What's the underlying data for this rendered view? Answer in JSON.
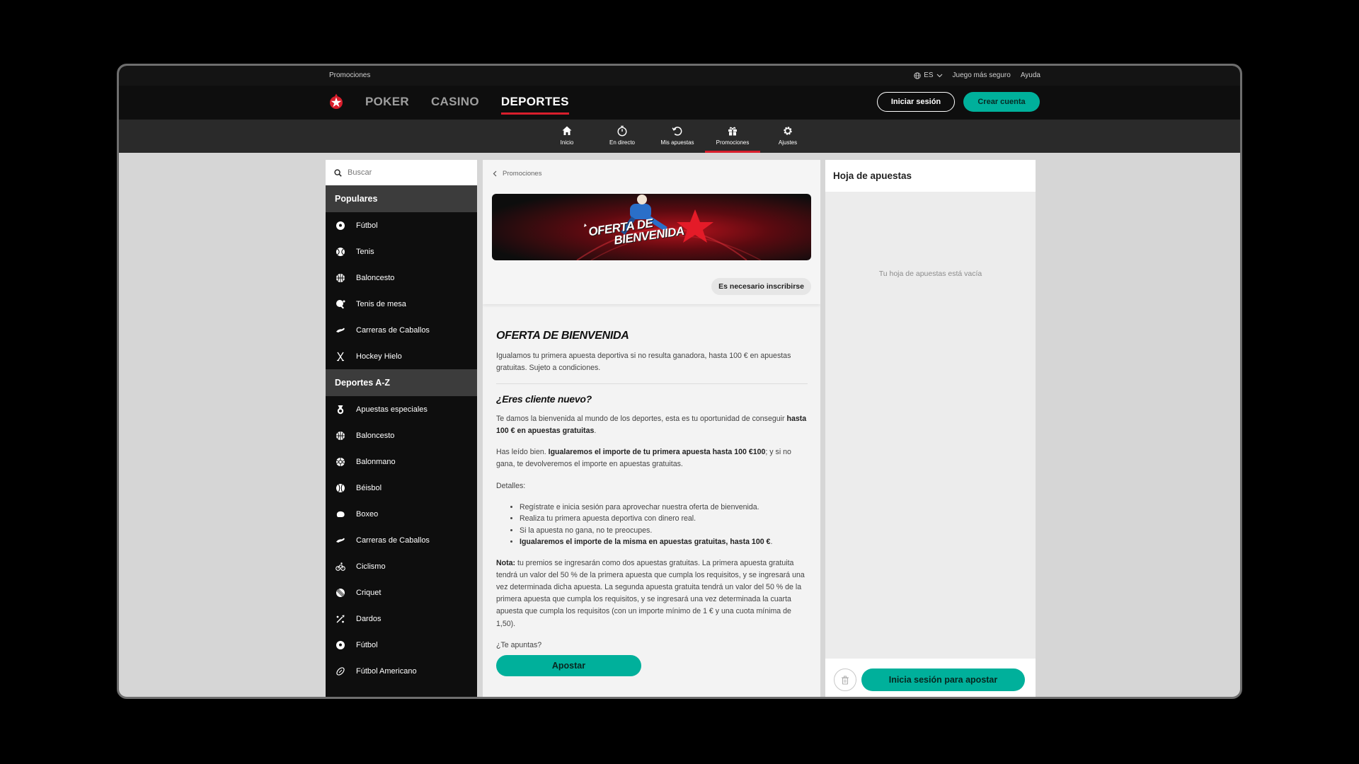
{
  "utility_bar": {
    "breadcrumb": "Promociones",
    "language": "ES",
    "safe_gaming": "Juego más seguro",
    "help": "Ayuda"
  },
  "header": {
    "nav": [
      "POKER",
      "CASINO",
      "DEPORTES"
    ],
    "active_nav": "DEPORTES",
    "login_label": "Iniciar sesión",
    "create_account_label": "Crear cuenta"
  },
  "subnav": {
    "items": [
      {
        "label": "Inicio",
        "icon": "home-icon"
      },
      {
        "label": "En directo",
        "icon": "stopwatch-icon"
      },
      {
        "label": "Mis apuestas",
        "icon": "history-icon"
      },
      {
        "label": "Promociones",
        "icon": "gift-icon"
      },
      {
        "label": "Ajustes",
        "icon": "gear-icon"
      }
    ],
    "active": "Promociones"
  },
  "sidebar": {
    "search_placeholder": "Buscar",
    "popular_title": "Populares",
    "popular": [
      "Fútbol",
      "Tenis",
      "Baloncesto",
      "Tenis de mesa",
      "Carreras de Caballos",
      "Hockey Hielo"
    ],
    "az_title": "Deportes A-Z",
    "az": [
      "Apuestas especiales",
      "Baloncesto",
      "Balonmano",
      "Béisbol",
      "Boxeo",
      "Carreras de Caballos",
      "Ciclismo",
      "Criquet",
      "Dardos",
      "Fútbol",
      "Fútbol Americano"
    ]
  },
  "content": {
    "breadcrumb": "Promociones",
    "banner_text_1": "OFERTA DE",
    "banner_text_2": "BIENVENIDA",
    "badge": "Es necesario inscribirse",
    "title": "OFERTA DE BIENVENIDA",
    "intro": "Igualamos tu primera apuesta deportiva si no resulta ganadora, hasta 100 € en apuestas gratuitas. Sujeto a condiciones.",
    "subtitle": "¿Eres cliente nuevo?",
    "p1_text": "Te damos la bienvenida al mundo de los deportes, esta es tu oportunidad de conseguir ",
    "p1_bold": "hasta 100 € en apuestas gratuitas",
    "p1_end": ".",
    "p2_text": "Has leído bien. ",
    "p2_bold": "Igualaremos el importe de tu primera apuesta hasta 100 €100",
    "p2_end": "; y si no gana, te devolveremos el importe en apuestas gratuitas.",
    "details_label": "Detalles:",
    "bullets": [
      "Regístrate e inicia sesión para aprovechar nuestra oferta de bienvenida.",
      "Realiza tu primera apuesta deportiva con dinero real.",
      "Si la apuesta no gana, no te preocupes."
    ],
    "bullet_bold": "Igualaremos el importe de la misma en apuestas gratuitas, hasta 100 €",
    "bullet_bold_end": ".",
    "note_label": "Nota:",
    "note_text": " tu premios se ingresarán como dos apuestas gratuitas. La primera apuesta gratuita tendrá un valor del 50 % de la primera apuesta que cumpla los requisitos, y se ingresará una vez determinada dicha apuesta. La segunda apuesta gratuita tendrá un valor del 50 % de la primera apuesta que cumpla los requisitos, y se ingresará una vez determinada la cuarta apuesta que cumpla los requisitos (con un importe mínimo de 1 € y una cuota mínima de 1,50).",
    "cta_question": "¿Te apuntas?",
    "cta_button": "Apostar"
  },
  "betslip": {
    "title": "Hoja de apuestas",
    "empty": "Tu hoja de apuestas está vacía",
    "signin_button": "Inicia sesión para apostar"
  },
  "colors": {
    "accent": "#00b09b",
    "brand_red": "#d81e2c",
    "header_bg": "#0e0e0e"
  }
}
